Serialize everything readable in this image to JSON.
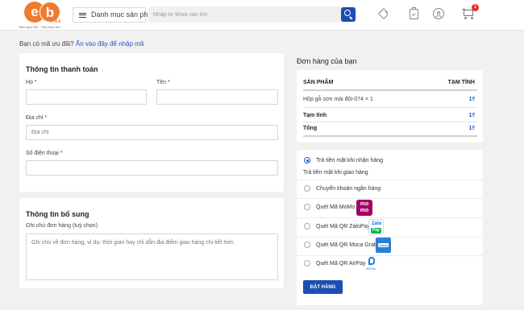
{
  "header": {
    "logo_letters": "eb",
    "logo_sub": "VINA",
    "logo_tagline": "Món quà nhỏ · Tấm nhìn lớn",
    "category_button": "Danh mục sản phẩm",
    "search_placeholder": "Nhập từ khoá cần tìm",
    "icons": [
      "tag-icon",
      "clipboard-icon",
      "user-icon",
      "cart-icon"
    ],
    "cart_count": "1"
  },
  "coupon": {
    "text": "Bạn có mã ưu đãi?",
    "link": "Ấn vào đây để nhập mã"
  },
  "billing": {
    "title": "Thông tin thanh toán",
    "last_name_label": "Họ *",
    "first_name_label": "Tên *",
    "address_label": "Địa chỉ *",
    "address_placeholder": "Địa chỉ",
    "phone_label": "Số điện thoại *"
  },
  "extra": {
    "title": "Thông tin bổ sung",
    "note_label": "Ghi chú đơn hàng (tuỳ chọn)",
    "note_placeholder": "Ghi chú về đơn hàng, ví dụ: thời gian hay chỉ dẫn địa điểm giao hàng chi tiết hơn."
  },
  "order": {
    "title": "Đơn hàng của bạn",
    "col_product": "SẢN PHẨM",
    "col_subtotal": "TẠM TÍNH",
    "item_name": "Hộp gỗ sơn mài đôi-074",
    "item_qty": "× 1",
    "item_price": "1₫",
    "subtotal_label": "Tạm tính",
    "subtotal_value": "1₫",
    "total_label": "Tổng",
    "total_value": "1₫"
  },
  "payment": {
    "cod": "Trả tiền mặt khi nhận hàng",
    "cod_note": "Trả tiền mặt khi giao hàng",
    "bank": "Chuyển khoản ngân hàng",
    "momo": "Quét Mã MoMo",
    "momo_logo": "mo mo",
    "zalopay": "Quét Mã QR ZaloPay",
    "zalopay_logo_top": "Zalo",
    "zalopay_logo_bottom": "Pay",
    "moca": "Quét Mã QR Moca Grab",
    "moca_logo": "moca",
    "airpay": "Quét Mã QR AirPay",
    "airpay_logo": "AirPay",
    "selected": "cod",
    "accent": "#1d4eb3"
  },
  "place_order": "ĐẶT HÀNG"
}
